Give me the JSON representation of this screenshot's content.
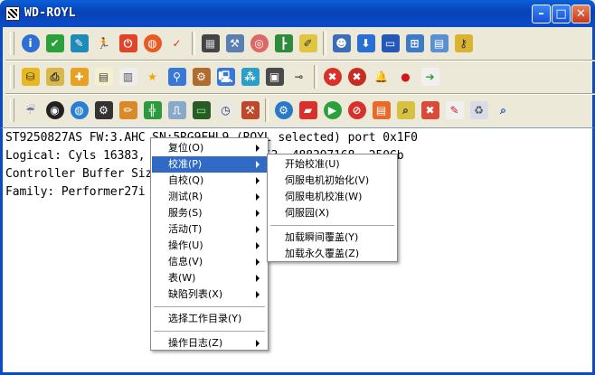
{
  "window": {
    "title": "WD-ROYL",
    "minimize_glyph": "–",
    "maximize_glyph": "□",
    "close_glyph": "✕"
  },
  "toolbar": {
    "rows": [
      [
        {
          "name": "info-icon",
          "glyph": "i",
          "bg": "#2f6fd1",
          "round": true
        },
        {
          "name": "shield-check-icon",
          "glyph": "✔",
          "bg": "#2aa13a"
        },
        {
          "name": "wrench-tool-icon",
          "glyph": "✎",
          "bg": "#1f8bb8"
        },
        {
          "name": "running-man-icon",
          "glyph": "🏃",
          "bg": "#ece9d8",
          "fg": "#1a8a1a"
        },
        {
          "name": "power-icon",
          "glyph": "⏻",
          "bg": "#e0442a"
        },
        {
          "name": "globe-icon",
          "glyph": "◍",
          "bg": "#e85a22",
          "round": true
        },
        {
          "name": "checkmark-icon",
          "glyph": "✓",
          "bg": "#ece9d8",
          "fg": "#d23a1a"
        },
        "sep",
        {
          "name": "memory-chip-icon",
          "glyph": "▦",
          "bg": "#444",
          "fg": "#ccc"
        },
        {
          "name": "hammer-chip-icon",
          "glyph": "⚒",
          "bg": "#5b7fb0"
        },
        {
          "name": "target-icon",
          "glyph": "◎",
          "bg": "#d66",
          "round": true
        },
        {
          "name": "tree-add-icon",
          "glyph": "┣",
          "bg": "#2e8b3a"
        },
        {
          "name": "edit-note-icon",
          "glyph": "✐",
          "bg": "#e0c640",
          "fg": "#333"
        },
        "sep",
        {
          "name": "user-config-icon",
          "glyph": "☻",
          "bg": "#3a6fb8"
        },
        {
          "name": "download-icon",
          "glyph": "⬇",
          "bg": "#2a6fd6"
        },
        {
          "name": "monitor-icon",
          "glyph": "▭",
          "bg": "#2458b8"
        },
        {
          "name": "network-card-icon",
          "glyph": "⊞",
          "bg": "#3e7ac8"
        },
        {
          "name": "display-panel-icon",
          "glyph": "▤",
          "bg": "#5a8fd0"
        },
        {
          "name": "key-icon",
          "glyph": "⚷",
          "bg": "#d8b432",
          "fg": "#333"
        }
      ],
      [
        {
          "name": "database-icon",
          "glyph": "⛁",
          "bg": "#e8b820",
          "fg": "#333"
        },
        {
          "name": "printer-icon",
          "glyph": "⎙",
          "bg": "#d9b84a",
          "fg": "#333"
        },
        {
          "name": "puzzle-icon",
          "glyph": "✚",
          "bg": "#e8a020"
        },
        {
          "name": "clipboard-icon",
          "glyph": "▤",
          "bg": "#f4f0d0",
          "fg": "#444"
        },
        {
          "name": "grid-list-icon",
          "glyph": "▥",
          "bg": "#eee",
          "fg": "#555"
        },
        {
          "name": "star-icon",
          "glyph": "★",
          "bg": "#ece9d8",
          "fg": "#f0a800"
        },
        {
          "name": "pin-icon",
          "glyph": "⚲",
          "bg": "#3a78d8"
        },
        {
          "name": "drill-icon",
          "glyph": "⚙",
          "bg": "#b06c2c"
        },
        {
          "name": "computer-icon",
          "glyph": "🖳",
          "bg": "#3a78d8"
        },
        {
          "name": "molecule-icon",
          "glyph": "⁂",
          "bg": "#2aa0c8"
        },
        {
          "name": "console-window-icon",
          "glyph": "▣",
          "bg": "#4a4a4a"
        },
        {
          "name": "connector-icon",
          "glyph": "⊸",
          "bg": "#ece9d8",
          "fg": "#555"
        },
        "sep",
        {
          "name": "stop-x-icon",
          "glyph": "✖",
          "bg": "#d8302a",
          "round": true
        },
        {
          "name": "cancel-x-icon",
          "glyph": "✖",
          "bg": "#c82a24",
          "round": true
        },
        {
          "name": "bell-icon",
          "glyph": "🔔",
          "bg": "#ece9d8",
          "fg": "#e09010"
        },
        {
          "name": "apple-bug-icon",
          "glyph": "●",
          "bg": "#ece9d8",
          "fg": "#d21818"
        },
        {
          "name": "export-file-icon",
          "glyph": "➔",
          "bg": "#f0f0f0",
          "fg": "#2a9a2a"
        }
      ],
      [
        {
          "name": "weather-icon",
          "glyph": "☔",
          "bg": "#ece9d8",
          "fg": "#6a7aa8"
        },
        {
          "name": "disk-platter-icon",
          "glyph": "◉",
          "bg": "#222",
          "round": true
        },
        {
          "name": "earth-icon",
          "glyph": "◍",
          "bg": "#2a7fd4",
          "round": true
        },
        {
          "name": "gears-icon",
          "glyph": "⚙",
          "bg": "#333"
        },
        {
          "name": "edit-pencil-icon",
          "glyph": "✏",
          "bg": "#d88a2a"
        },
        {
          "name": "network-tree-icon",
          "glyph": "╬",
          "bg": "#2c9a3c"
        },
        {
          "name": "network-device-icon",
          "glyph": "⎍",
          "bg": "#8aa8c8"
        },
        {
          "name": "terminal-icon",
          "glyph": "▭",
          "bg": "#2a5a2a",
          "fg": "#7f7"
        },
        {
          "name": "clock-icon",
          "glyph": "◷",
          "bg": "#e8e8e8",
          "fg": "#333",
          "round": true
        },
        {
          "name": "tools-box-icon",
          "glyph": "⚒",
          "bg": "#c0482a"
        },
        "sep",
        {
          "name": "settings-gear-icon",
          "glyph": "⚙",
          "bg": "#2a78c8",
          "round": true
        },
        {
          "name": "car-icon",
          "glyph": "▰",
          "bg": "#d8302a"
        },
        {
          "name": "play-icon",
          "glyph": "▶",
          "bg": "#2aa03a",
          "round": true
        },
        {
          "name": "no-entry-icon",
          "glyph": "⊘",
          "bg": "#d8302a",
          "round": true
        },
        {
          "name": "book-icon",
          "glyph": "▤",
          "bg": "#e86a2a"
        },
        {
          "name": "magnifier-doc-icon",
          "glyph": "⌕",
          "bg": "#d8c040",
          "fg": "#333"
        },
        {
          "name": "close-box-icon",
          "glyph": "✖",
          "bg": "#d84a3a"
        },
        {
          "name": "document-edit-icon",
          "glyph": "✎",
          "bg": "#f0f0f0",
          "fg": "#c22"
        },
        {
          "name": "recycle-bin-icon",
          "glyph": "♻",
          "bg": "#d8dce8",
          "fg": "#555"
        },
        {
          "name": "search-icon",
          "glyph": "⌕",
          "bg": "#ece9d8",
          "fg": "#1a5ab8"
        }
      ]
    ]
  },
  "output": {
    "lines": [
      "ST9250827AS FW:3.AHC SN:5RG9FHL9 (ROYL selected) port 0x1F0",
      "Logical: Cyls 16383, Heads 16, Sects 63, 488397168, 250Gb",
      "Controller Buffer Size: 8Mb",
      "Family: Performer27i"
    ]
  },
  "context_menu": {
    "items": [
      {
        "label": "复位(O)",
        "submenu": true
      },
      {
        "label": "校准(P)",
        "submenu": true,
        "selected": true
      },
      {
        "label": "自校(Q)",
        "submenu": true
      },
      {
        "label": "测试(R)",
        "submenu": true
      },
      {
        "label": "服务(S)",
        "submenu": true
      },
      {
        "label": "活动(T)",
        "submenu": true
      },
      {
        "label": "操作(U)",
        "submenu": true
      },
      {
        "label": "信息(V)",
        "submenu": true
      },
      {
        "label": "表(W)",
        "submenu": true
      },
      {
        "label": "缺陷列表(X)",
        "submenu": true
      },
      "sep",
      {
        "label": "选择工作目录(Y)",
        "submenu": false
      },
      "sep",
      {
        "label": "操作日志(Z)",
        "submenu": true
      }
    ]
  },
  "submenu": {
    "items": [
      {
        "label": "开始校准(U)"
      },
      {
        "label": "伺服电机初始化(V)"
      },
      {
        "label": "伺服电机校准(W)"
      },
      {
        "label": "伺服园(X)"
      },
      "sep",
      {
        "label": "加载瞬间覆盖(Y)"
      },
      {
        "label": "加载永久覆盖(Z)"
      }
    ]
  },
  "colors": {
    "titlebar": "#0a4cc8",
    "menu_highlight": "#316ac5",
    "face": "#ece9d8"
  }
}
